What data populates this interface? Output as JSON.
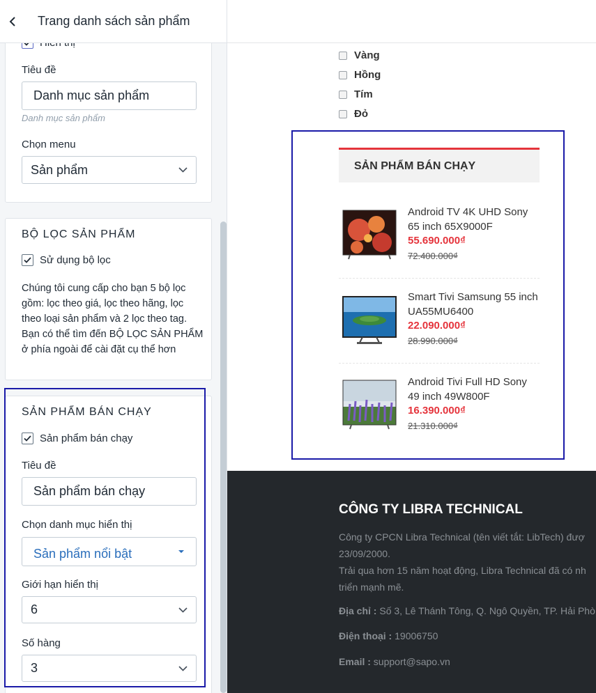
{
  "left_panel": {
    "header_title": "Trang danh sách sản phẩm",
    "top_card": {
      "partial_checkbox_label": "Hiển thị",
      "title_label": "Tiêu đề",
      "title_value": "Danh mục sản phẩm",
      "title_hint": "Danh mục sản phẩm",
      "menu_label": "Chọn menu",
      "menu_value": "Sản phẩm"
    },
    "filter_card": {
      "heading": "BỘ LỌC SẢN PHẨM",
      "checkbox_label": "Sử dụng bộ lọc",
      "checked": true,
      "description": "Chúng tôi cung cấp cho bạn 5 bộ lọc gồm: lọc theo giá, lọc theo hãng, lọc theo loại sản phẩm và 2 lọc theo tag. Bạn có thể tìm đến BỘ LỌC SẢN PHẨM ở phía ngoài để cài đặt cụ thể hơn"
    },
    "bestseller_card": {
      "heading": "SẢN PHẨM BÁN CHẠY",
      "checkbox_label": "Sản phẩm bán chạy",
      "checked": true,
      "title_label": "Tiêu đề",
      "title_value": "Sản phẩm bán chạy",
      "category_label": "Chọn danh mục hiển thị",
      "category_value": "Sản phẩm nổi bật",
      "limit_label": "Giới hạn hiển thị",
      "limit_value": "6",
      "rows_label": "Số hàng",
      "rows_value": "3"
    }
  },
  "preview": {
    "color_filters": [
      "Vàng",
      "Hồng",
      "Tím",
      "Đỏ"
    ],
    "bestseller_heading": "SẢN PHẨM BÁN CHẠY",
    "products": [
      {
        "name": "Android TV 4K UHD Sony 65 inch 65X9000F",
        "price": "55.690.000₫",
        "old_price": "72.400.000₫",
        "image": "tv-flower-image"
      },
      {
        "name": "Smart Tivi Samsung 55 inch UA55MU6400",
        "price": "22.090.000₫",
        "old_price": "28.990.000₫",
        "image": "tv-island-image"
      },
      {
        "name": "Android Tivi Full HD Sony 49 inch 49W800F",
        "price": "16.390.000₫",
        "old_price": "21.310.000₫",
        "image": "tv-lavender-image"
      }
    ],
    "footer": {
      "company_title": "CÔNG TY LIBRA TECHNICAL",
      "intro_line1": "Công ty CPCN Libra Technical (tên viết tắt: LibTech) đượ",
      "intro_line2": "23/09/2000.",
      "intro_line3": "Trải qua hơn 15 năm hoạt động, Libra Technical đã có nh",
      "intro_line4": "triển mạnh mẽ.",
      "address_label": "Địa chỉ :",
      "address_value": " Số 3, Lê Thánh Tông, Q. Ngô Quyền, TP. Hải Phò",
      "phone_label": "Điện thoại :",
      "phone_value": " 19006750",
      "email_label": "Email :",
      "email_value": " support@sapo.vn"
    }
  },
  "colors": {
    "accent_red": "#e5343c",
    "highlight_blue": "#1a1aa8",
    "footer_bg": "#24282c",
    "link_blue": "#2a6ebb"
  }
}
